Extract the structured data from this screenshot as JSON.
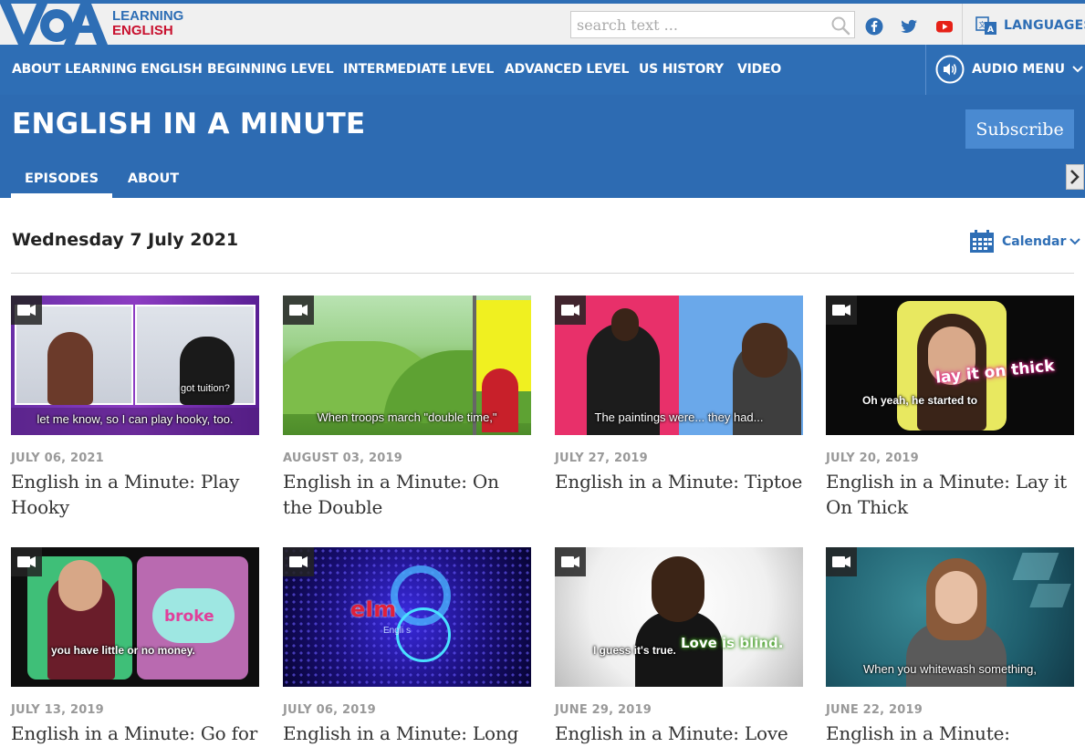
{
  "brand": {
    "logo_text": "VOA",
    "line1": "LEARNING",
    "line2": "ENGLISH"
  },
  "search": {
    "placeholder": "search text ..."
  },
  "social": [
    "facebook-icon",
    "twitter-icon",
    "youtube-icon"
  ],
  "colors": {
    "brand_blue": "#2e6eb5",
    "brand_red": "#c8102e",
    "facebook": "#3b5998",
    "twitter": "#1da1f2",
    "youtube": "#e62117"
  },
  "languages_label": "LANGUAGES",
  "nav": {
    "items": [
      "ABOUT LEARNING ENGLISH",
      "BEGINNING LEVEL",
      "INTERMEDIATE LEVEL",
      "ADVANCED LEVEL",
      "US HISTORY",
      "VIDEO"
    ],
    "audio_menu": "AUDIO MENU"
  },
  "program": {
    "title": "ENGLISH IN A MINUTE",
    "subscribe": "Subscribe",
    "tabs": [
      "EPISODES",
      "ABOUT"
    ]
  },
  "listing": {
    "date": "Wednesday 7 July 2021",
    "calendar_label": "Calendar"
  },
  "cards": [
    {
      "date": "JULY 06, 2021",
      "title": "English in a Minute: Play Hooky",
      "caption": "let me know, so I can play hooky, too.",
      "overlay": "got tuition?"
    },
    {
      "date": "AUGUST 03, 2019",
      "title": "English in a Minute: On the Double",
      "caption": "When troops march \"double time,\"",
      "overlay": ""
    },
    {
      "date": "JULY 27, 2019",
      "title": "English in a Minute: Tiptoe",
      "caption": "The paintings were... they had...",
      "overlay": ""
    },
    {
      "date": "JULY 20, 2019",
      "title": "English in a Minute: Lay it On Thick",
      "caption": "Oh yeah, he started to",
      "overlay": "lay it on thick"
    },
    {
      "date": "JULY 13, 2019",
      "title": "English in a Minute: Go for",
      "caption": "you have little or no money.",
      "overlay": "broke"
    },
    {
      "date": "JULY 06, 2019",
      "title": "English in a Minute: Long",
      "caption": "",
      "overlay": "eIm",
      "overlay2": "Engli s"
    },
    {
      "date": "JUNE 29, 2019",
      "title": "English in a Minute: Love is",
      "caption": "I guess it's true.",
      "overlay": "Love is blind."
    },
    {
      "date": "JUNE 22, 2019",
      "title": "English in a Minute:",
      "caption": "When you whitewash something,",
      "overlay": ""
    }
  ]
}
